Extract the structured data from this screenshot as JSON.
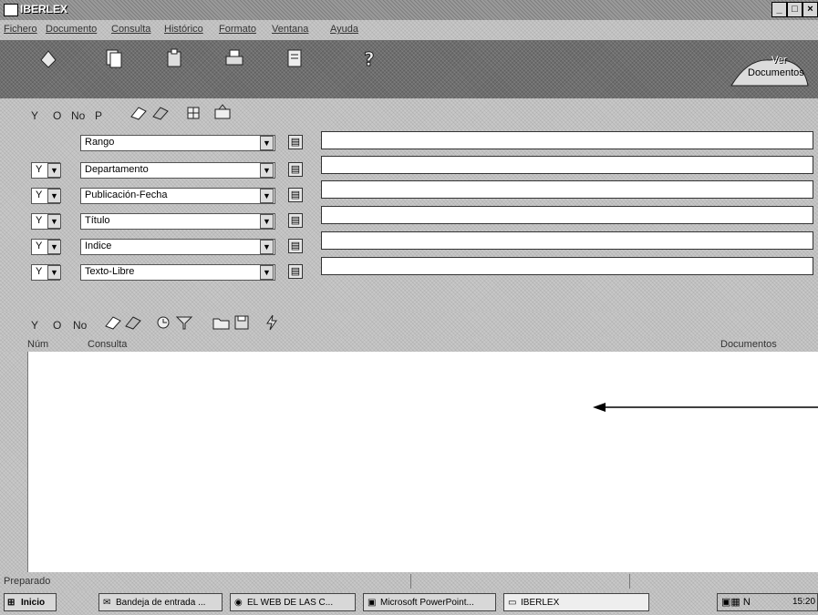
{
  "window": {
    "title": "IBERLEX"
  },
  "menu": [
    "Fichero",
    "Documento",
    "Consulta",
    "Histórico",
    "Formato",
    "Ventana",
    "Ayuda"
  ],
  "toolbar": {
    "ver_documentos_line1": "Ver",
    "ver_documentos_line2": "Documentos"
  },
  "query_toolbar": {
    "op_y": "Y",
    "op_o": "O",
    "op_no": "No",
    "op_p": "P"
  },
  "query_rows": [
    {
      "operator": "",
      "field": "Rango",
      "value": ""
    },
    {
      "operator": "Y",
      "field": "Departamento",
      "value": ""
    },
    {
      "operator": "Y",
      "field": "Publicación-Fecha",
      "value": ""
    },
    {
      "operator": "Y",
      "field": "Título",
      "value": ""
    },
    {
      "operator": "Y",
      "field": "Indice",
      "value": ""
    },
    {
      "operator": "Y",
      "field": "Texto-Libre",
      "value": ""
    }
  ],
  "results_toolbar": {
    "op_y": "Y",
    "op_o": "O",
    "op_no": "No"
  },
  "list": {
    "col_num": "Núm",
    "col_consulta": "Consulta",
    "col_documentos": "Documentos"
  },
  "status": {
    "text": "Preparado"
  },
  "taskbar": {
    "start": "Inicio",
    "tasks": [
      "Bandeja de entrada ...",
      "EL WEB DE LAS C...",
      "Microsoft PowerPoint...",
      "IBERLEX"
    ],
    "clock": "15:20"
  },
  "colors": {
    "title_bg": "#9a9a9a",
    "panel_bg": "#c8c8c8",
    "toolbar_dark": "#6e6e6e"
  }
}
